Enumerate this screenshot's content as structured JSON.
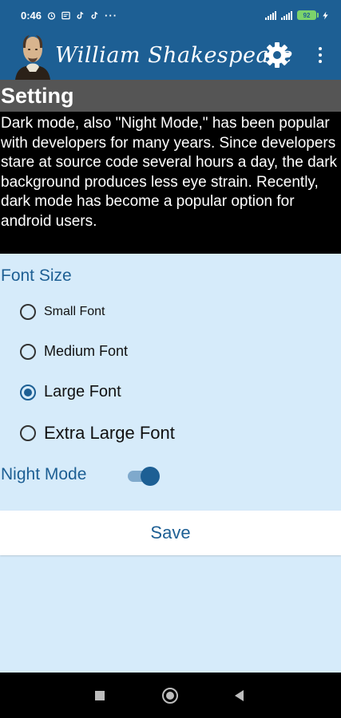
{
  "status_bar": {
    "time": "0:46",
    "battery": "92",
    "more_notifications": "···"
  },
  "app_bar": {
    "title": "William Shakespeare",
    "icons": [
      "portrait-logo",
      "gear-icon",
      "more-vert-icon"
    ]
  },
  "section_title": "Setting",
  "description": "Dark mode, also \"Night Mode,\" has been popular with developers for many years. Since developers stare at source code several hours a day, the dark background produces less eye strain. Recently, dark mode has become a popular option for android users.",
  "font_size": {
    "label": "Font Size",
    "selected": "Large Font",
    "options": [
      {
        "label": "Small Font",
        "checked": false
      },
      {
        "label": "Medium Font",
        "checked": false
      },
      {
        "label": "Large Font",
        "checked": true
      },
      {
        "label": "Extra Large Font",
        "checked": false
      }
    ]
  },
  "night_mode": {
    "label": "Night Mode",
    "enabled": true
  },
  "save_label": "Save",
  "colors": {
    "primary": "#1d5f94",
    "page_background": "#d6ebfa",
    "section_header": "#555555",
    "description_background": "#000000"
  }
}
